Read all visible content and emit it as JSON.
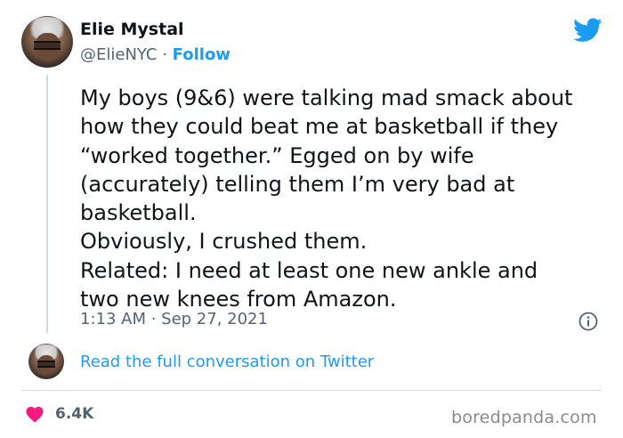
{
  "author": {
    "name": "Elie Mystal",
    "handle": "@ElieNYC",
    "separator": " · ",
    "follow_label": "Follow"
  },
  "tweet": {
    "text": "My boys (9&6) were talking mad smack about\nhow they could beat me at basketball if they\n“worked together.” Egged on by wife\n(accurately) telling them I’m very bad at\nbasketball.\nObviously, I crushed them.\nRelated: I need at least one new ankle and\ntwo new knees from Amazon.",
    "timestamp": "1:13 AM · Sep 27, 2021"
  },
  "conversation_link": "Read the full conversation on Twitter",
  "likes": "6.4K",
  "watermark": "boredpanda.com",
  "icons": {
    "brand": "twitter-bird-icon",
    "info": "info-icon",
    "like": "heart-icon"
  },
  "colors": {
    "accent": "#1d9bf0",
    "heart": "#f91880",
    "secondary_text": "#536471"
  }
}
